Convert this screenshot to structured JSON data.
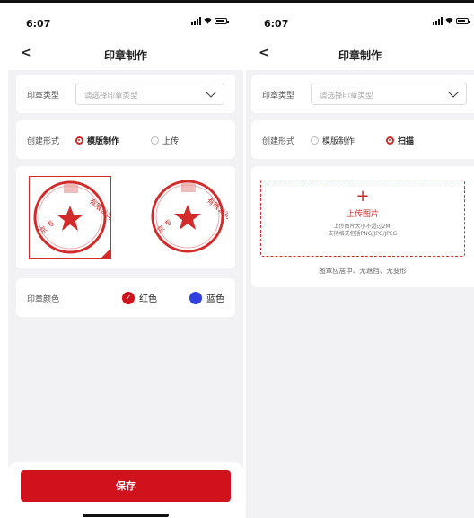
{
  "colors": {
    "accent": "#d0121d",
    "blue": "#2f3fe0",
    "bg": "#f2f2f4"
  },
  "left": {
    "status_time": "6:07",
    "nav_title": "印章制作",
    "back_icon": "chevron-left-icon",
    "seal_type": {
      "label": "印章类型",
      "placeholder": "请选择印章类型"
    },
    "create_mode": {
      "label": "创建形式",
      "options": [
        "模版制作",
        "上传"
      ],
      "selected": "模版制作"
    },
    "seal_templates": [
      {
        "name": "template-1",
        "selected": true,
        "text": "有限公司",
        "bottom_text": "京 专"
      },
      {
        "name": "template-2",
        "selected": false,
        "text": "有限公司",
        "bottom_text": "京 专"
      }
    ],
    "seal_color": {
      "label": "印章颜色",
      "options": [
        "红色",
        "蓝色"
      ],
      "selected": "红色"
    },
    "save_label": "保存"
  },
  "right": {
    "status_time": "6:07",
    "nav_title": "印章制作",
    "back_icon": "chevron-left-icon",
    "seal_type": {
      "label": "印章类型",
      "placeholder": "请选择印章类型"
    },
    "create_mode": {
      "label": "创建形式",
      "options": [
        "模版制作",
        "扫描"
      ],
      "selected": "扫描"
    },
    "upload": {
      "plus": "+",
      "title": "上传图片",
      "hint1": "上传图片大小不超过2M,",
      "hint2": "支持格式包括PNG/JPG/JPEG",
      "note": "图章应居中、无遮挡、无变形"
    }
  }
}
